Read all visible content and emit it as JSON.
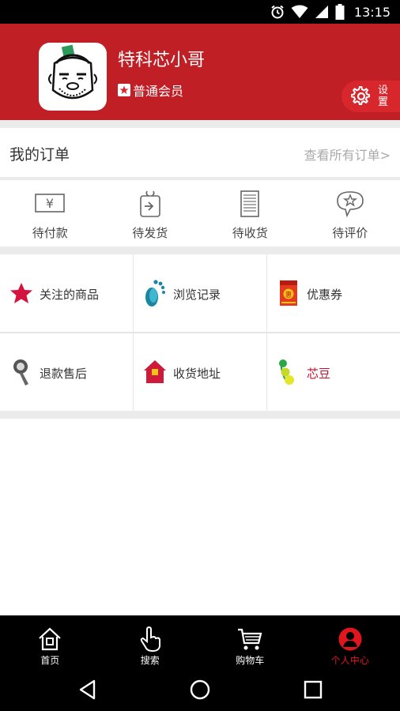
{
  "status_bar": {
    "time": "13:15",
    "icons": [
      "alarm-icon",
      "wifi-icon",
      "signal-icon",
      "battery-icon"
    ]
  },
  "profile": {
    "username": "特科芯小哥",
    "member_level": "普通会员",
    "settings_label": "设置"
  },
  "orders": {
    "title": "我的订单",
    "view_all": "查看所有订单>",
    "statuses": [
      {
        "label": "待付款",
        "icon": "yen-icon"
      },
      {
        "label": "待发货",
        "icon": "ship-icon"
      },
      {
        "label": "待收货",
        "icon": "receipt-icon"
      },
      {
        "label": "待评价",
        "icon": "review-star-icon"
      }
    ]
  },
  "grid": [
    {
      "label": "关注的商品",
      "icon": "star-icon"
    },
    {
      "label": "浏览记录",
      "icon": "footprint-icon"
    },
    {
      "label": "优惠券",
      "icon": "coupon-icon"
    },
    {
      "label": "退款售后",
      "icon": "refund-icon"
    },
    {
      "label": "收货地址",
      "icon": "home-icon"
    },
    {
      "label": "芯豆",
      "icon": "bean-icon"
    }
  ],
  "tabs": [
    {
      "label": "首页",
      "icon": "home-tab-icon"
    },
    {
      "label": "搜索",
      "icon": "hand-pointer-icon"
    },
    {
      "label": "购物车",
      "icon": "cart-icon"
    },
    {
      "label": "个人中心",
      "icon": "person-icon",
      "active": true
    }
  ],
  "colors": {
    "brand_red": "#bf1f25",
    "active_tab": "#e0161e"
  }
}
